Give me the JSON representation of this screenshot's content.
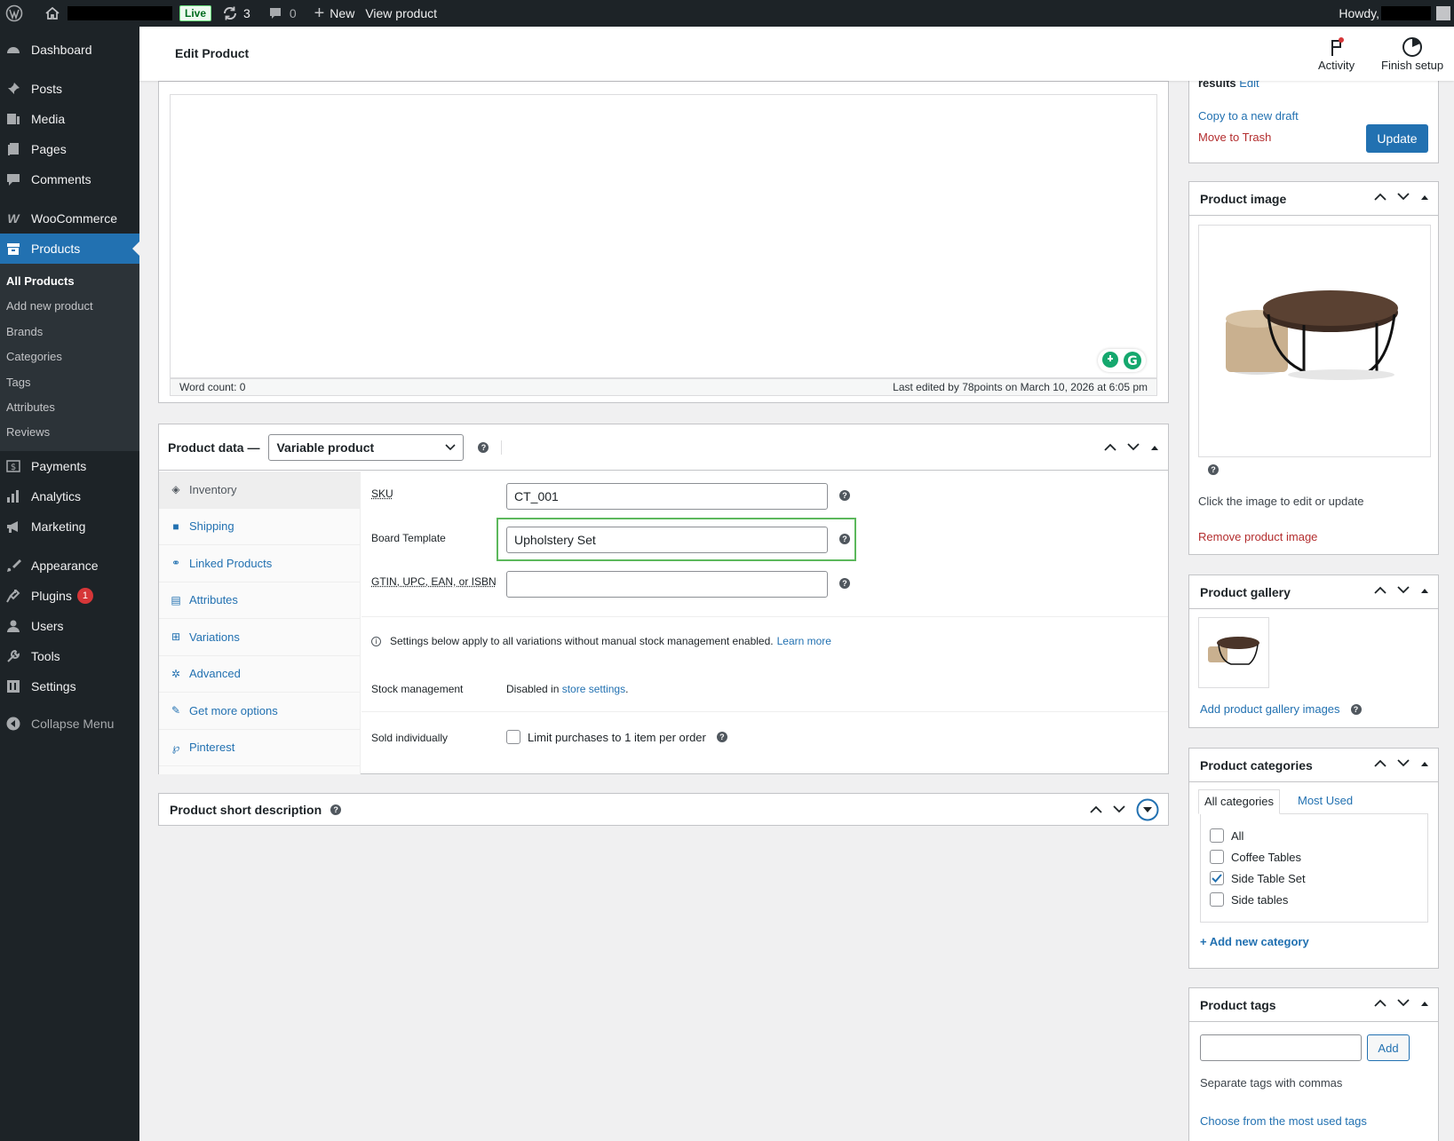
{
  "adminbar": {
    "live": "Live",
    "updates": "3",
    "comments": "0",
    "new": "New",
    "view": "View product",
    "howdy": "Howdy,"
  },
  "sidebar": {
    "items": [
      {
        "label": "Dashboard",
        "icon": "dashboard-icon"
      },
      {
        "label": "Posts",
        "icon": "pin-icon"
      },
      {
        "label": "Media",
        "icon": "media-icon"
      },
      {
        "label": "Pages",
        "icon": "pages-icon"
      },
      {
        "label": "Comments",
        "icon": "comment-icon"
      },
      {
        "label": "WooCommerce",
        "icon": "woo-icon"
      },
      {
        "label": "Products",
        "icon": "archive-icon"
      },
      {
        "label": "Payments",
        "icon": "payments-icon"
      },
      {
        "label": "Analytics",
        "icon": "analytics-icon"
      },
      {
        "label": "Marketing",
        "icon": "megaphone-icon"
      },
      {
        "label": "Appearance",
        "icon": "brush-icon"
      },
      {
        "label": "Plugins",
        "icon": "plugin-icon",
        "badge": "1"
      },
      {
        "label": "Users",
        "icon": "user-icon"
      },
      {
        "label": "Tools",
        "icon": "wrench-icon"
      },
      {
        "label": "Settings",
        "icon": "settings-icon"
      },
      {
        "label": "Collapse Menu",
        "icon": "collapse-icon"
      }
    ],
    "submenu": [
      "All Products",
      "Add new product",
      "Brands",
      "Categories",
      "Tags",
      "Attributes",
      "Reviews"
    ]
  },
  "header": {
    "title": "Edit Product",
    "activity": "Activity",
    "finish": "Finish setup"
  },
  "editor": {
    "word_count": "Word count: 0",
    "last_edited": "Last edited by 78points on March 10, 2026 at 6:05 pm"
  },
  "product_data": {
    "label": "Product data —",
    "type": "Variable product",
    "tabs": [
      "Inventory",
      "Shipping",
      "Linked Products",
      "Attributes",
      "Variations",
      "Advanced",
      "Get more options",
      "Pinterest"
    ],
    "sku_label": "SKU",
    "sku_value": "CT_001",
    "board_label": "Board Template",
    "board_value": "Upholstery Set",
    "gtin_label": "GTIN, UPC, EAN, or ISBN",
    "gtin_value": "",
    "notice": "Settings below apply to all variations without manual stock management enabled.",
    "learn_more": "Learn more",
    "stock_label": "Stock management",
    "stock_text": "Disabled in",
    "stock_link": "store settings",
    "sold_label": "Sold individually",
    "sold_text": "Limit purchases to 1 item per order"
  },
  "short_desc": {
    "title": "Product short description"
  },
  "publish": {
    "results": "results",
    "edit": "Edit",
    "copy": "Copy to a new draft",
    "trash": "Move to Trash",
    "update": "Update"
  },
  "product_image": {
    "title": "Product image",
    "hint": "Click the image to edit or update",
    "remove": "Remove product image"
  },
  "gallery": {
    "title": "Product gallery",
    "add": "Add product gallery images"
  },
  "categories": {
    "title": "Product categories",
    "tab_all": "All categories",
    "tab_most": "Most Used",
    "items": [
      {
        "label": "All",
        "checked": false
      },
      {
        "label": "Coffee Tables",
        "checked": false
      },
      {
        "label": "Side Table Set",
        "checked": true
      },
      {
        "label": "Side tables",
        "checked": false
      }
    ],
    "add": "+ Add new category"
  },
  "tags": {
    "title": "Product tags",
    "add": "Add",
    "hint": "Separate tags with commas",
    "choose": "Choose from the most used tags"
  },
  "colors": {
    "accent": "#2271b1",
    "admin_bg": "#1d2327",
    "highlight": "#5cb85c",
    "danger": "#d63638"
  }
}
